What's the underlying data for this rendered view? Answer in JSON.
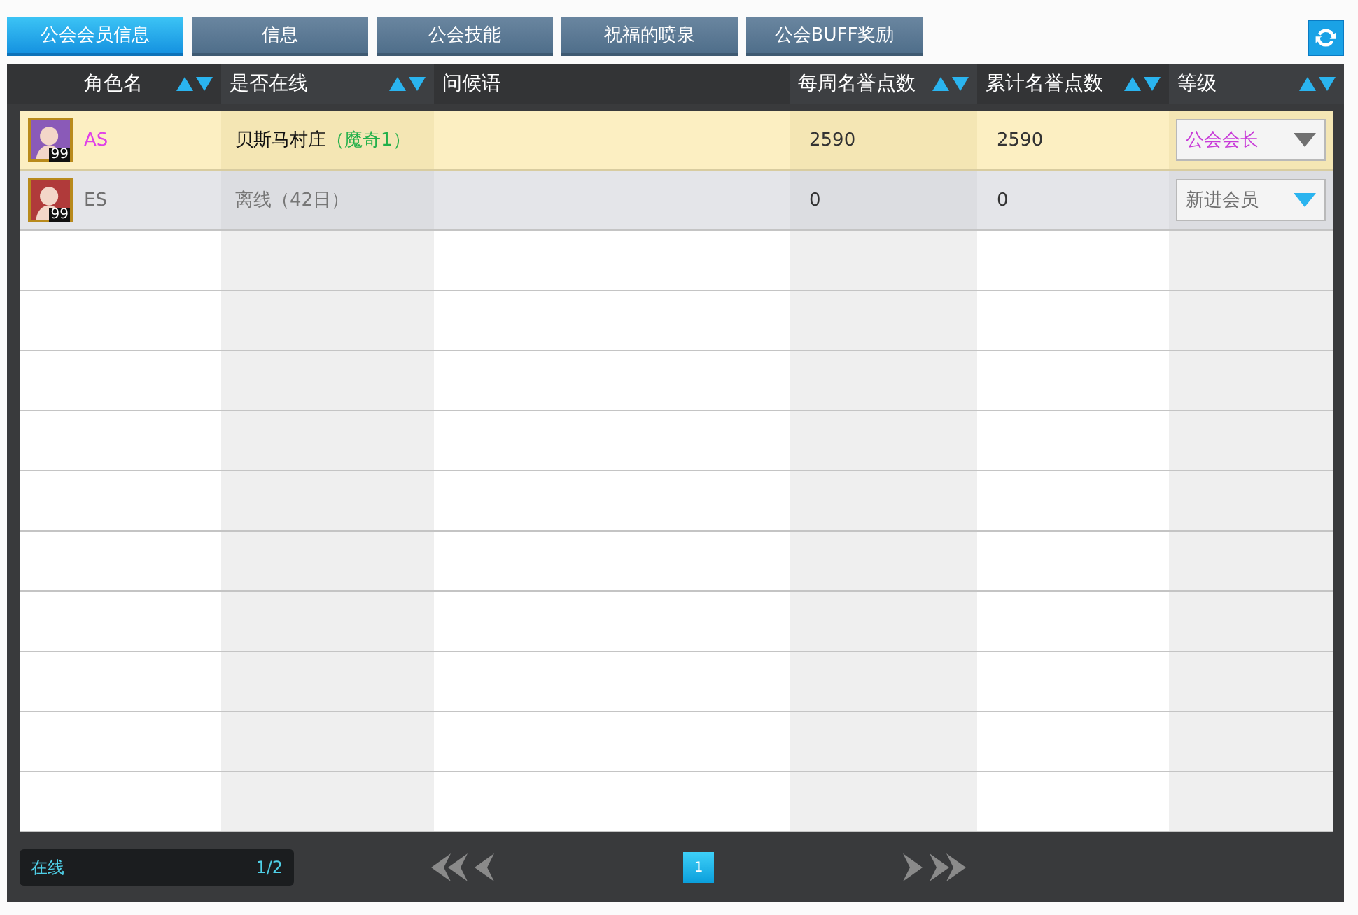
{
  "tabs": [
    {
      "label": "公会会员信息",
      "selected": true
    },
    {
      "label": "信息",
      "selected": false
    },
    {
      "label": "公会技能",
      "selected": false
    },
    {
      "label": "祝福的喷泉",
      "selected": false
    },
    {
      "label": "公会BUFF奖励",
      "selected": false
    }
  ],
  "table": {
    "columns": [
      {
        "label": "角色名",
        "sortable": true
      },
      {
        "label": "是否在线",
        "sortable": true
      },
      {
        "label": "问候语",
        "sortable": false
      },
      {
        "label": "每周名誉点数",
        "sortable": true
      },
      {
        "label": "累计名誉点数",
        "sortable": true
      },
      {
        "label": "等级",
        "sortable": true
      }
    ],
    "rows": [
      {
        "selected": true,
        "level": "99",
        "name": "AS",
        "kind": "master",
        "online": true,
        "status": "贝斯马村庄",
        "channel": "（魔奇1）",
        "weekly": "2590",
        "total": "2590",
        "rank": "公会会长",
        "rank_editable": false
      },
      {
        "selected": false,
        "level": "99",
        "name": "ES",
        "kind": "member",
        "online": false,
        "status": "离线（42日）",
        "weekly": "0",
        "total": "0",
        "rank": "新进会员",
        "rank_editable": true
      }
    ]
  },
  "footer": {
    "label": "在线",
    "count": "1/2",
    "pages": [
      {
        "label": "1",
        "selected": true
      }
    ]
  }
}
